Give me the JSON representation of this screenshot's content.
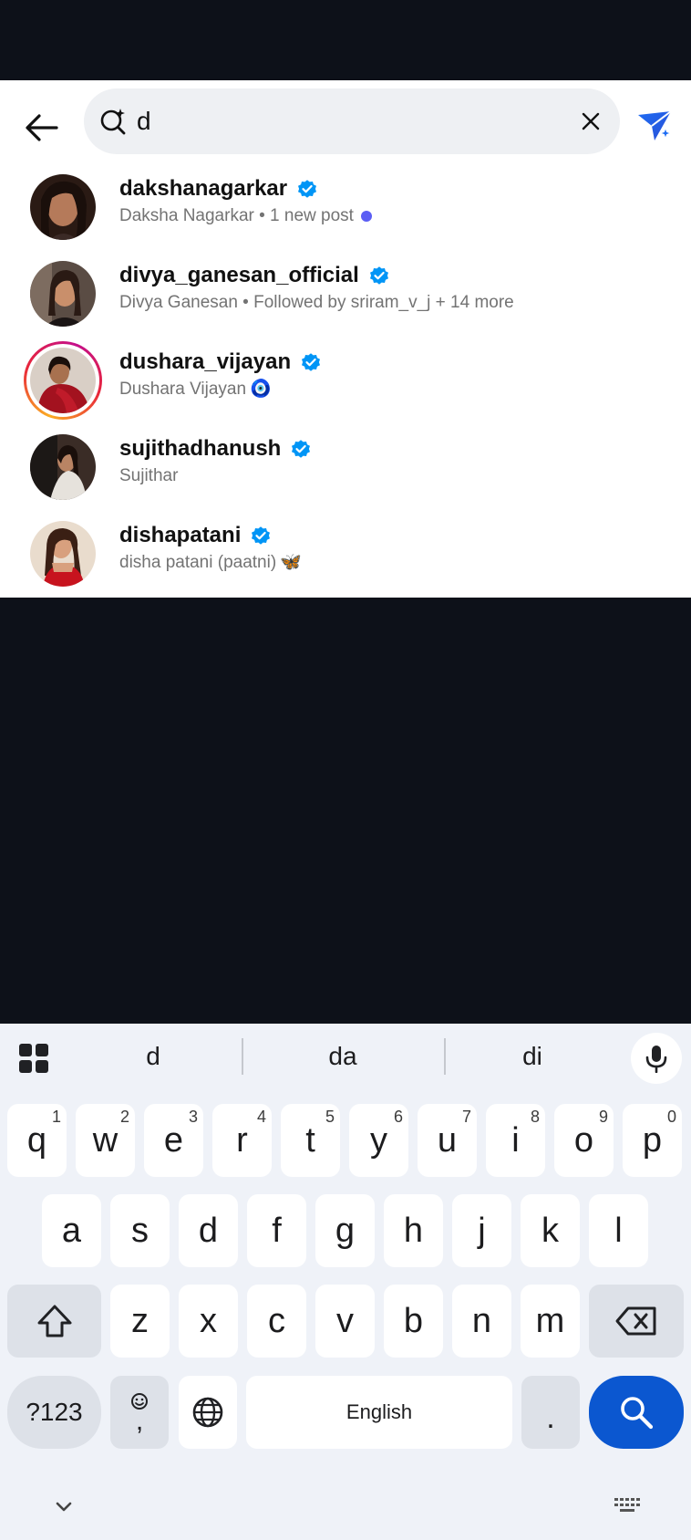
{
  "search": {
    "value": "d"
  },
  "results": [
    {
      "username": "dakshanagarkar",
      "subtitle": "Daksha Nagarkar • 1 new post",
      "verified": true,
      "new_post": true
    },
    {
      "username": "divya_ganesan_official",
      "subtitle": "Divya Ganesan • Followed by sriram_v_j + 14 more",
      "verified": true
    },
    {
      "username": "dushara_vijayan",
      "subtitle": "Dushara Vijayan",
      "subtitle_emoji": "🧿",
      "verified": true,
      "story_ring": true
    },
    {
      "username": "sujithadhanush",
      "subtitle": "Sujithar",
      "verified": true
    },
    {
      "username": "dishapatani",
      "subtitle": "disha patani (paatni)",
      "subtitle_emoji": "🦋",
      "verified": true
    }
  ],
  "keyboard": {
    "suggestions": [
      "d",
      "da",
      "di"
    ],
    "row1": [
      {
        "k": "q",
        "n": "1"
      },
      {
        "k": "w",
        "n": "2"
      },
      {
        "k": "e",
        "n": "3"
      },
      {
        "k": "r",
        "n": "4"
      },
      {
        "k": "t",
        "n": "5"
      },
      {
        "k": "y",
        "n": "6"
      },
      {
        "k": "u",
        "n": "7"
      },
      {
        "k": "i",
        "n": "8"
      },
      {
        "k": "o",
        "n": "9"
      },
      {
        "k": "p",
        "n": "0"
      }
    ],
    "row2": [
      "a",
      "s",
      "d",
      "f",
      "g",
      "h",
      "j",
      "k",
      "l"
    ],
    "row3": [
      "z",
      "x",
      "c",
      "v",
      "b",
      "n",
      "m"
    ],
    "symbols_label": "?123",
    "comma_label": ",",
    "space_label": "English",
    "period_label": "."
  },
  "colors": {
    "verified": "#0095f6",
    "action_key": "#0b57d0",
    "new_post_dot": "#5b5ef4"
  }
}
